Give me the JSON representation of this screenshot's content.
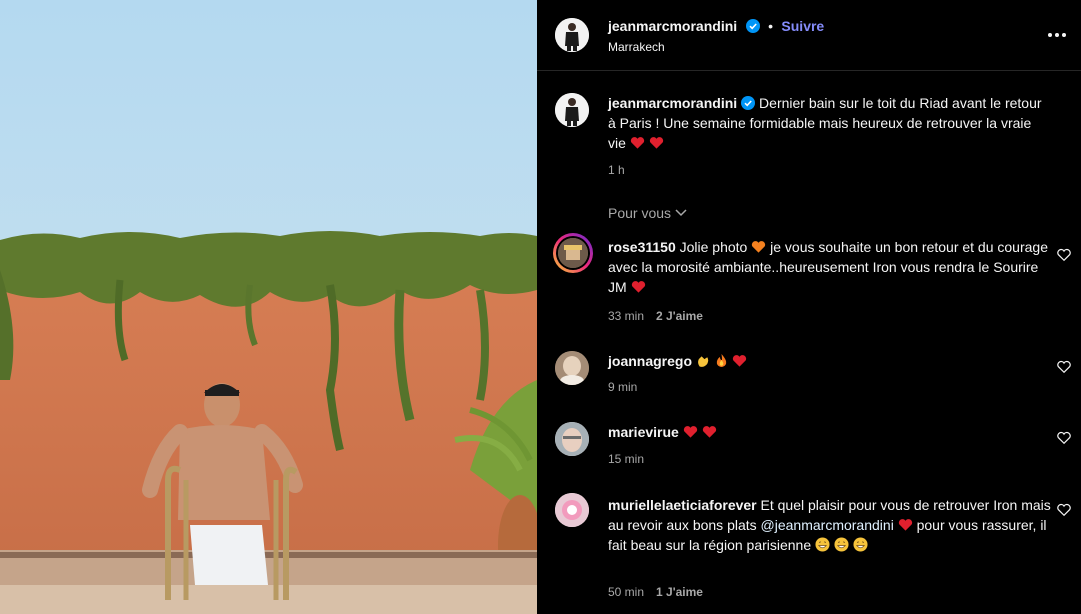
{
  "post": {
    "username": "jeanmarcmorandini",
    "follow_label": "Suivre",
    "location": "Marrakech",
    "more_icon": "more-horizontal-icon",
    "caption_user": "jeanmarcmorandini",
    "caption_text": "Dernier bain sur le toit du Riad avant le retour à Paris ! Une semaine formidable mais heureux de retrouver la vraie vie",
    "time": "1 h",
    "for_you": "Pour vous",
    "accent": "#0095f6",
    "follow_color": "#858cfa"
  },
  "comments": [
    {
      "user": "rose31150",
      "text_a": "Jolie photo",
      "text_b": "je vous souhaite un bon retour et du courage avec la morosité ambiante..heureusement Iron vous rendra le Sourire JM",
      "time": "33 min",
      "likes": "2 J'aime"
    },
    {
      "user": "joannagrego",
      "time": "9 min"
    },
    {
      "user": "marievirue",
      "time": "15 min"
    },
    {
      "user": "muriellelaeticiaforever",
      "text_a": "Et quel plaisir pour vous de retrouver Iron mais au revoir aux bons plats",
      "mention": "@jeanmarcmorandini",
      "text_b": "pour vous rassurer, il fait beau sur la région parisienne",
      "time": "50 min",
      "likes": "1 J'aime"
    }
  ]
}
